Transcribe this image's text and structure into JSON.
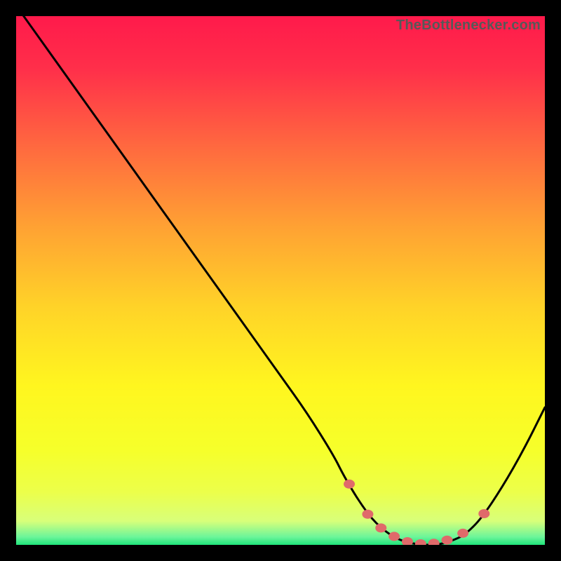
{
  "attribution": "TheBottlenecker.com",
  "chart_data": {
    "type": "line",
    "title": "",
    "xlabel": "",
    "ylabel": "",
    "xlim": [
      0,
      100
    ],
    "ylim": [
      0,
      100
    ],
    "series": [
      {
        "name": "bottleneck-curve",
        "x": [
          0,
          5,
          10,
          15,
          20,
          25,
          30,
          35,
          40,
          45,
          50,
          55,
          60,
          62,
          65,
          68,
          72,
          76,
          80,
          83,
          85,
          88,
          92,
          96,
          100
        ],
        "values": [
          102,
          95,
          88,
          81,
          74,
          67,
          60,
          53,
          46,
          39,
          32,
          25,
          17,
          13,
          8,
          4,
          1,
          0,
          0,
          1,
          2,
          5,
          11,
          18,
          26
        ]
      }
    ],
    "markers": {
      "name": "highlight-dots",
      "points": [
        {
          "x": 63.0,
          "y": 11.5
        },
        {
          "x": 66.5,
          "y": 5.8
        },
        {
          "x": 69.0,
          "y": 3.2
        },
        {
          "x": 71.5,
          "y": 1.6
        },
        {
          "x": 74.0,
          "y": 0.6
        },
        {
          "x": 76.5,
          "y": 0.2
        },
        {
          "x": 79.0,
          "y": 0.3
        },
        {
          "x": 81.5,
          "y": 0.9
        },
        {
          "x": 84.5,
          "y": 2.2
        },
        {
          "x": 88.5,
          "y": 5.9
        }
      ]
    },
    "gradient_stops": [
      {
        "offset": 0.0,
        "color": "#ff1a4b"
      },
      {
        "offset": 0.1,
        "color": "#ff2f4a"
      },
      {
        "offset": 0.25,
        "color": "#ff6a3f"
      },
      {
        "offset": 0.4,
        "color": "#ffa233"
      },
      {
        "offset": 0.55,
        "color": "#ffd328"
      },
      {
        "offset": 0.7,
        "color": "#fff61f"
      },
      {
        "offset": 0.82,
        "color": "#f6ff2a"
      },
      {
        "offset": 0.9,
        "color": "#ecff4a"
      },
      {
        "offset": 0.955,
        "color": "#d8ff7a"
      },
      {
        "offset": 0.985,
        "color": "#6cf59a"
      },
      {
        "offset": 1.0,
        "color": "#1fe47a"
      }
    ],
    "marker_color": "#e06a6a",
    "curve_color": "#000000"
  }
}
